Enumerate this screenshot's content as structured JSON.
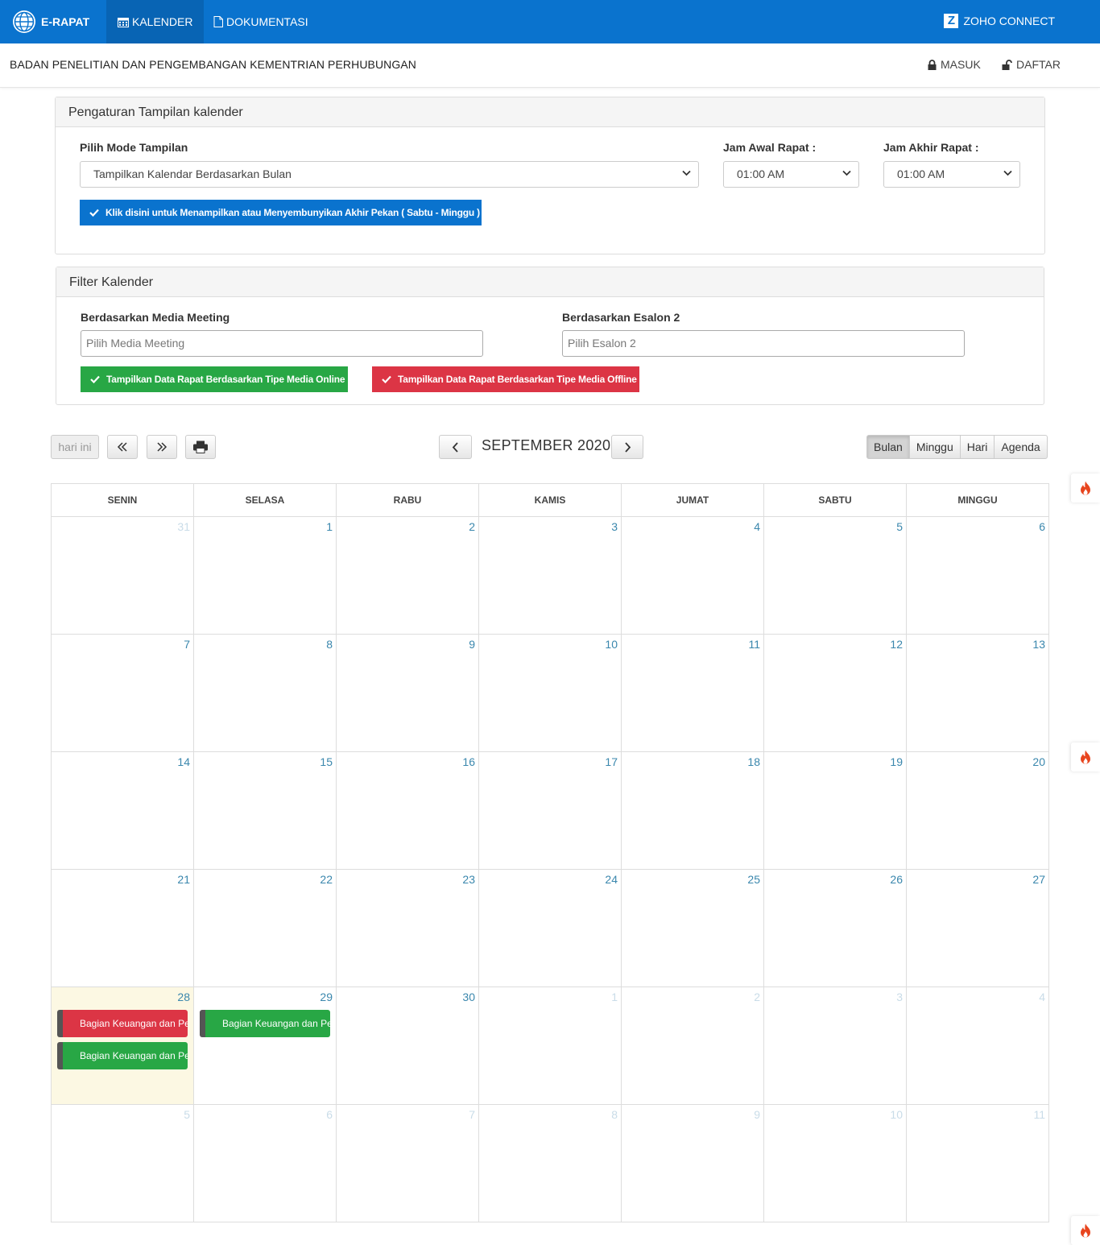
{
  "nav": {
    "brand": "E-RAPAT",
    "kalender": "KALENDER",
    "dokumentasi": "DOKUMENTASI",
    "zoho": "ZOHO CONNECT",
    "zoho_letter": "Z"
  },
  "subheader": {
    "org": "BADAN PENELITIAN DAN PENGEMBANGAN KEMENTRIAN PERHUBUNGAN",
    "masuk": "MASUK",
    "daftar": "DAFTAR"
  },
  "settings": {
    "title": "Pengaturan Tampilan kalender",
    "mode_label": "Pilih Mode Tampilan",
    "mode_value": "Tampilkan Kalendar Berdasarkan Bulan",
    "jam_awal_label": "Jam Awal Rapat :",
    "jam_awal_value": "01:00 AM",
    "jam_akhir_label": "Jam Akhir Rapat :",
    "jam_akhir_value": "01:00 AM",
    "weekend_button": "Klik disini untuk Menampilkan atau Menyembunyikan Akhir Pekan ( Sabtu - Minggu )"
  },
  "filter": {
    "title": "Filter Kalender",
    "media_label": "Berdasarkan Media Meeting",
    "media_placeholder": "Pilih Media Meeting",
    "esalon_label": "Berdasarkan Esalon 2",
    "esalon_placeholder": "Pilih Esalon 2",
    "online_button": "Tampilkan Data Rapat Berdasarkan Tipe Media Online",
    "offline_button": "Tampilkan Data Rapat Berdasarkan Tipe Media Offline"
  },
  "toolbar": {
    "today": "hari ini",
    "month_title": "SEPTEMBER 2020",
    "views": [
      "Bulan",
      "Minggu",
      "Hari",
      "Agenda"
    ],
    "active_view": "Bulan"
  },
  "calendar": {
    "weekdays": [
      "SENIN",
      "SELASA",
      "RABU",
      "KAMIS",
      "JUMAT",
      "SABTU",
      "MINGGU"
    ],
    "weeks": [
      [
        {
          "d": "31",
          "o": true
        },
        {
          "d": "1"
        },
        {
          "d": "2"
        },
        {
          "d": "3"
        },
        {
          "d": "4"
        },
        {
          "d": "5"
        },
        {
          "d": "6"
        }
      ],
      [
        {
          "d": "7"
        },
        {
          "d": "8"
        },
        {
          "d": "9"
        },
        {
          "d": "10"
        },
        {
          "d": "11"
        },
        {
          "d": "12"
        },
        {
          "d": "13"
        }
      ],
      [
        {
          "d": "14"
        },
        {
          "d": "15"
        },
        {
          "d": "16"
        },
        {
          "d": "17"
        },
        {
          "d": "18"
        },
        {
          "d": "19"
        },
        {
          "d": "20"
        }
      ],
      [
        {
          "d": "21"
        },
        {
          "d": "22"
        },
        {
          "d": "23"
        },
        {
          "d": "24"
        },
        {
          "d": "25"
        },
        {
          "d": "26"
        },
        {
          "d": "27"
        }
      ],
      [
        {
          "d": "28",
          "today": true,
          "events": [
            {
              "t": "Bagian Keuangan dan Perl",
              "c": "red"
            },
            {
              "t": "Bagian Keuangan dan Perl",
              "c": "green"
            }
          ]
        },
        {
          "d": "29",
          "events": [
            {
              "t": "Bagian Keuangan dan Perl",
              "c": "green"
            }
          ]
        },
        {
          "d": "30"
        },
        {
          "d": "1",
          "o": true
        },
        {
          "d": "2",
          "o": true
        },
        {
          "d": "3",
          "o": true
        },
        {
          "d": "4",
          "o": true
        }
      ],
      [
        {
          "d": "5",
          "o": true
        },
        {
          "d": "6",
          "o": true
        },
        {
          "d": "7",
          "o": true
        },
        {
          "d": "8",
          "o": true
        },
        {
          "d": "9",
          "o": true
        },
        {
          "d": "10",
          "o": true
        },
        {
          "d": "11",
          "o": true
        }
      ]
    ]
  },
  "colors": {
    "nav_bg": "#0a73ce",
    "online": "#28a745",
    "offline": "#dc3545",
    "weekend_btn": "#0a73ce",
    "today_bg": "#fcf8e3",
    "day_number": "#3a87ad"
  }
}
